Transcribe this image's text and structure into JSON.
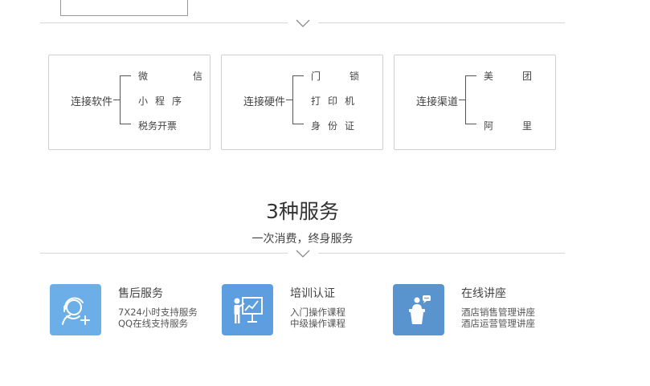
{
  "cards": [
    {
      "title": "连接软件",
      "items": [
        [
          "微",
          "信"
        ],
        [
          "小",
          "程",
          "序"
        ],
        [
          "税务开票"
        ]
      ]
    },
    {
      "title": "连接硬件",
      "items": [
        [
          "门",
          "锁"
        ],
        [
          "打",
          "印",
          "机"
        ],
        [
          "身",
          "份",
          "证"
        ]
      ]
    },
    {
      "title": "连接渠道",
      "items": [
        [
          "美",
          "团"
        ],
        [],
        [
          "阿",
          "里"
        ]
      ]
    }
  ],
  "services_section": {
    "title": "3种服务",
    "subtitle": "一次消费，终身服务"
  },
  "services": [
    {
      "name": "售后服务",
      "lines": [
        "7X24小时支持服务",
        "QQ在线支持服务"
      ],
      "icon": "headset-support-icon",
      "color": "#6caee8"
    },
    {
      "name": "培训认证",
      "lines": [
        "入门操作课程",
        "中级操作课程"
      ],
      "icon": "presentation-board-icon",
      "color": "#5c9ee0"
    },
    {
      "name": "在线讲座",
      "lines": [
        "酒店销售管理讲座",
        "酒店运营管理讲座"
      ],
      "icon": "podium-speaker-icon",
      "color": "#5a94cf"
    }
  ]
}
